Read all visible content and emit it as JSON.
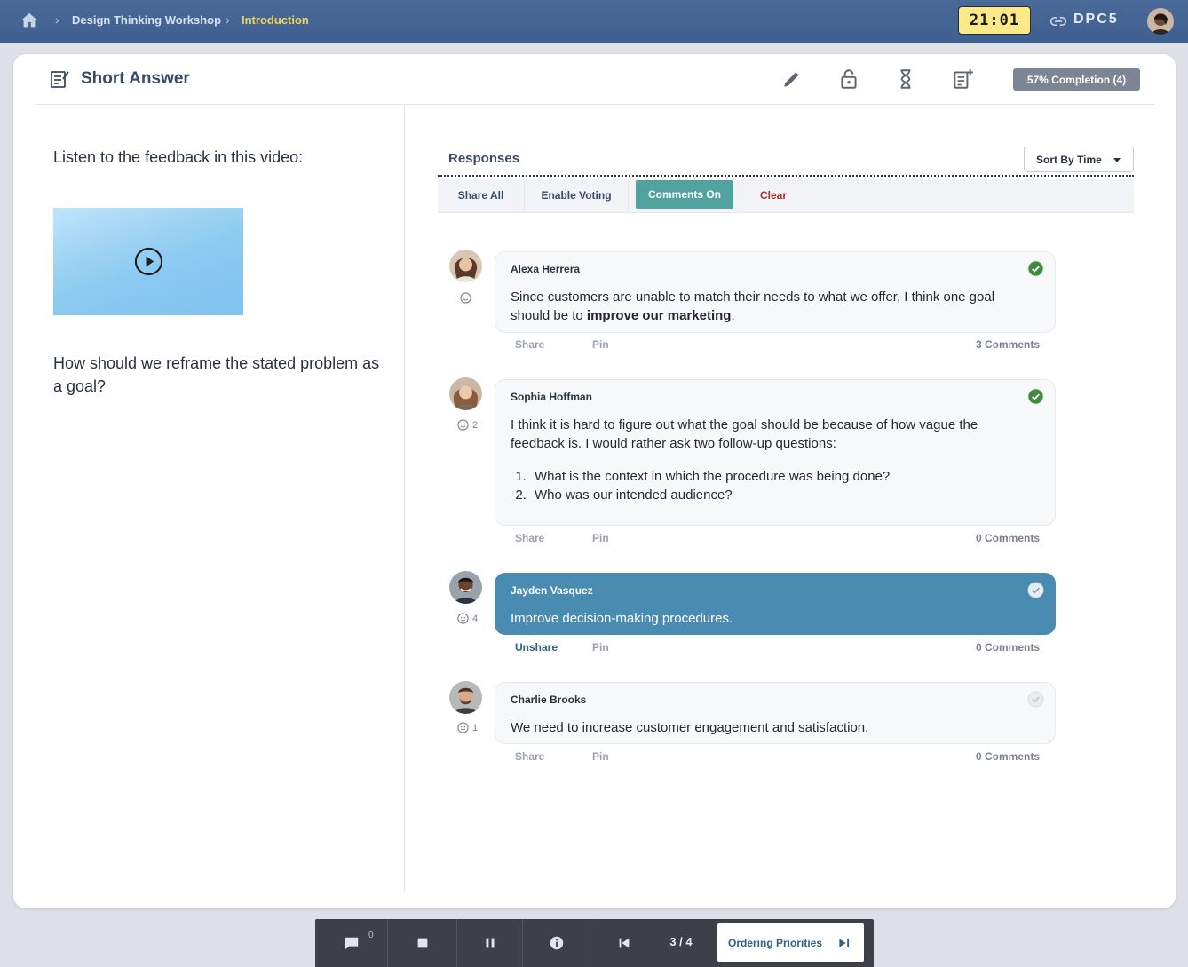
{
  "topbar": {
    "breadcrumbs": [
      "Design Thinking Workshop",
      "Introduction"
    ],
    "timer": "21:01",
    "session_code": "DPC5"
  },
  "activity": {
    "title": "Short Answer",
    "completion": "57% Completion (4)"
  },
  "prompt": {
    "intro": "Listen to the feedback in this video:",
    "question": "How should we reframe the stated problem as a goal?"
  },
  "responses": {
    "title": "Responses",
    "sort_label": "Sort By Time",
    "tabs": {
      "share_all": "Share All",
      "enable_voting": "Enable Voting",
      "comments_on": "Comments On",
      "clear": "Clear"
    },
    "items": [
      {
        "author": "Alexa Herrera",
        "reactions": "",
        "text_before": "Since customers are unable to match their needs to what we offer, I think one goal should be to ",
        "text_bold": "improve our marketing",
        "text_after": ".",
        "share_label": "Share",
        "pin_label": "Pin",
        "comments": "3 Comments",
        "approved": true
      },
      {
        "author": "Sophia Hoffman",
        "reactions": "2",
        "text": "I think it is hard to figure out what the goal should be because of how vague the feedback is. I would rather ask two follow-up questions:",
        "list": [
          "What is the context in which the procedure was being done?",
          "Who was our intended audience?"
        ],
        "share_label": "Share",
        "pin_label": "Pin",
        "comments": "0 Comments",
        "approved": true
      },
      {
        "author": "Jayden Vasquez",
        "reactions": "4",
        "text": "Improve decision-making procedures.",
        "share_label": "Unshare",
        "pin_label": "Pin",
        "comments": "0 Comments",
        "shared": true
      },
      {
        "author": "Charlie Brooks",
        "reactions": "1",
        "text": "We need to increase customer engagement and satisfaction.",
        "share_label": "Share",
        "pin_label": "Pin",
        "comments": "0 Comments",
        "approved": false
      }
    ]
  },
  "bottombar": {
    "chat_count": "0",
    "pager": "3 / 4",
    "next_activity": "Ordering Priorities"
  },
  "colors": {
    "topbar": "#3e5f90",
    "accent_teal": "#52a39f",
    "shared_blue": "#4a8bb2",
    "approved_green": "#3f8a3c",
    "timer_bg": "#fbe98a"
  }
}
